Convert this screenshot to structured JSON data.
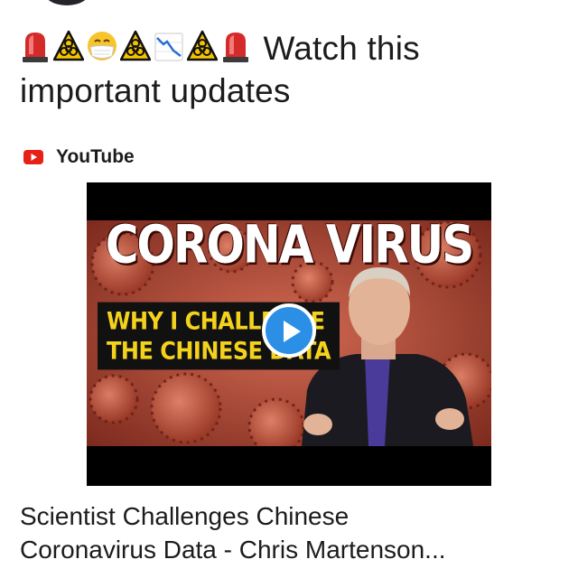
{
  "post": {
    "emojis": [
      "rotating-light-icon",
      "biohazard-icon",
      "face-with-mask-icon",
      "biohazard-icon",
      "chart-decreasing-icon",
      "biohazard-icon",
      "rotating-light-icon"
    ],
    "text_line1": "Watch this",
    "text_line2": "important updates"
  },
  "link_preview": {
    "source_icon": "youtube-icon",
    "source_name": "YouTube",
    "thumbnail": {
      "title": "CORONA VIRUS",
      "subtitle_line1": "WHY I CHALLENGE",
      "subtitle_line2": "THE CHINESE DATA",
      "play_icon": "play-icon"
    },
    "title_line1": "Scientist Challenges Chinese",
    "title_line2": "Coronavirus Data - Chris Martenson..."
  },
  "colors": {
    "youtube_red": "#e62117",
    "play_button": "#2b8fe6",
    "subtitle_text": "#f4d21c",
    "thumbnail_bg": "#b8513c"
  }
}
